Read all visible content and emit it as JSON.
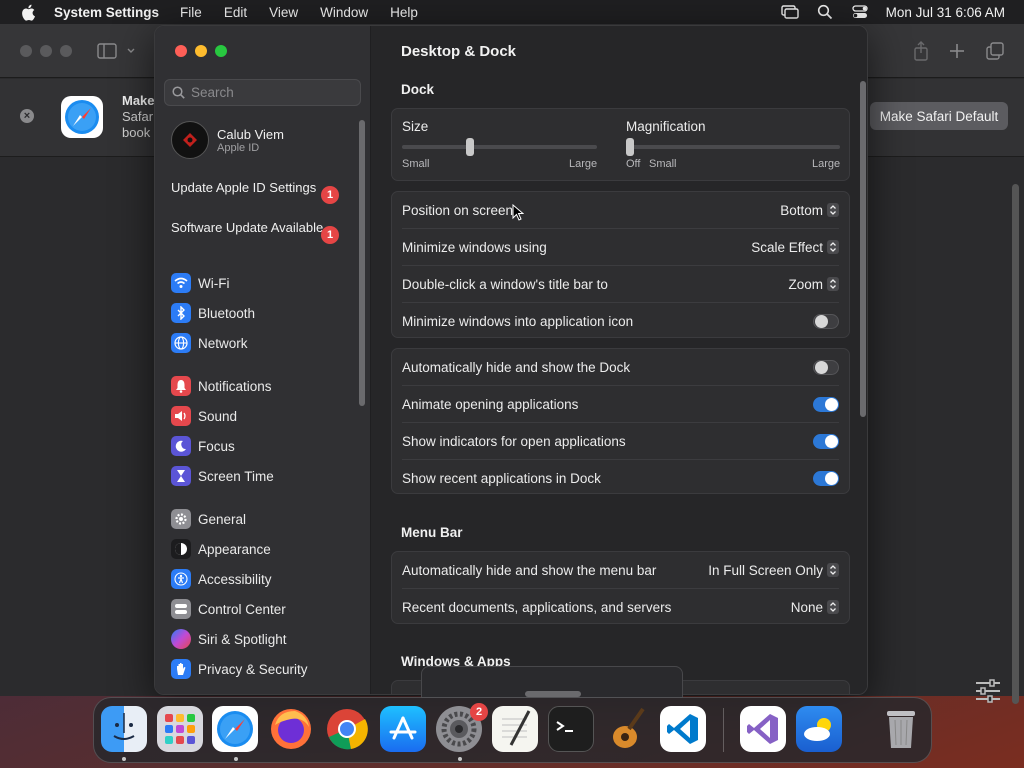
{
  "menubar": {
    "app_name": "System Settings",
    "menus": [
      "File",
      "Edit",
      "View",
      "Window",
      "Help"
    ],
    "clock": "Mon Jul 31  6:06 AM"
  },
  "safari": {
    "banner_title": "Make",
    "banner_line2": "Safar",
    "banner_line3": "book",
    "make_default_label": "Make Safari Default"
  },
  "settings": {
    "search_placeholder": "Search",
    "profile": {
      "name": "Calub Viem",
      "subtitle": "Apple ID"
    },
    "notices": [
      {
        "label": "Update Apple ID Settings",
        "badge": "1"
      },
      {
        "label": "Software Update Available",
        "badge": "1"
      }
    ],
    "sidebar_items": [
      {
        "label": "Wi-Fi",
        "icon": "wifi-icon",
        "color": "#2c7cf6"
      },
      {
        "label": "Bluetooth",
        "icon": "bluetooth-icon",
        "color": "#2c7cf6"
      },
      {
        "label": "Network",
        "icon": "globe-icon",
        "color": "#2c7cf6"
      },
      {
        "label": "Notifications",
        "icon": "bell-icon",
        "color": "#e5484d"
      },
      {
        "label": "Sound",
        "icon": "speaker-icon",
        "color": "#e5484d"
      },
      {
        "label": "Focus",
        "icon": "moon-icon",
        "color": "#5b55d6"
      },
      {
        "label": "Screen Time",
        "icon": "hourglass-icon",
        "color": "#5b55d6"
      },
      {
        "label": "General",
        "icon": "gear-icon",
        "color": "#8e8e93"
      },
      {
        "label": "Appearance",
        "icon": "appearance-icon",
        "color": "#1c1c1e"
      },
      {
        "label": "Accessibility",
        "icon": "accessibility-icon",
        "color": "#2c7cf6"
      },
      {
        "label": "Control Center",
        "icon": "control-center-icon",
        "color": "#8e8e93"
      },
      {
        "label": "Siri & Spotlight",
        "icon": "siri-icon",
        "color": "#c04ad6"
      },
      {
        "label": "Privacy & Security",
        "icon": "hand-icon",
        "color": "#2c7cf6"
      }
    ],
    "content": {
      "title": "Desktop & Dock",
      "dock_section": "Dock",
      "size": {
        "label": "Size",
        "min": "Small",
        "max": "Large",
        "value": 0.35
      },
      "magnification": {
        "label": "Magnification",
        "off": "Off",
        "min": "Small",
        "max": "Large",
        "value": 0.0
      },
      "position": {
        "label": "Position on screen",
        "value": "Bottom"
      },
      "minimize_using": {
        "label": "Minimize windows using",
        "value": "Scale Effect"
      },
      "double_click": {
        "label": "Double-click a window's title bar to",
        "value": "Zoom"
      },
      "minimize_into_icon": {
        "label": "Minimize windows into application icon",
        "on": false
      },
      "autohide_dock": {
        "label": "Automatically hide and show the Dock",
        "on": false
      },
      "animate": {
        "label": "Animate opening applications",
        "on": true
      },
      "indicators": {
        "label": "Show indicators for open applications",
        "on": true
      },
      "recent_apps": {
        "label": "Show recent applications in Dock",
        "on": true
      },
      "menubar_section": "Menu Bar",
      "autohide_menubar": {
        "label": "Automatically hide and show the menu bar",
        "value": "In Full Screen Only"
      },
      "recent_docs": {
        "label": "Recent documents, applications, and servers",
        "value": "None"
      },
      "windows_section": "Windows & Apps"
    }
  },
  "dock": {
    "badge": "2",
    "apps": [
      "finder-icon",
      "launchpad-icon",
      "safari-icon",
      "firefox-icon",
      "chrome-icon",
      "app-store-icon",
      "system-settings-icon",
      "textedit-icon",
      "terminal-icon",
      "garageband-icon",
      "vscode-icon",
      "visual-studio-icon",
      "weather-icon",
      "trash-icon"
    ]
  }
}
